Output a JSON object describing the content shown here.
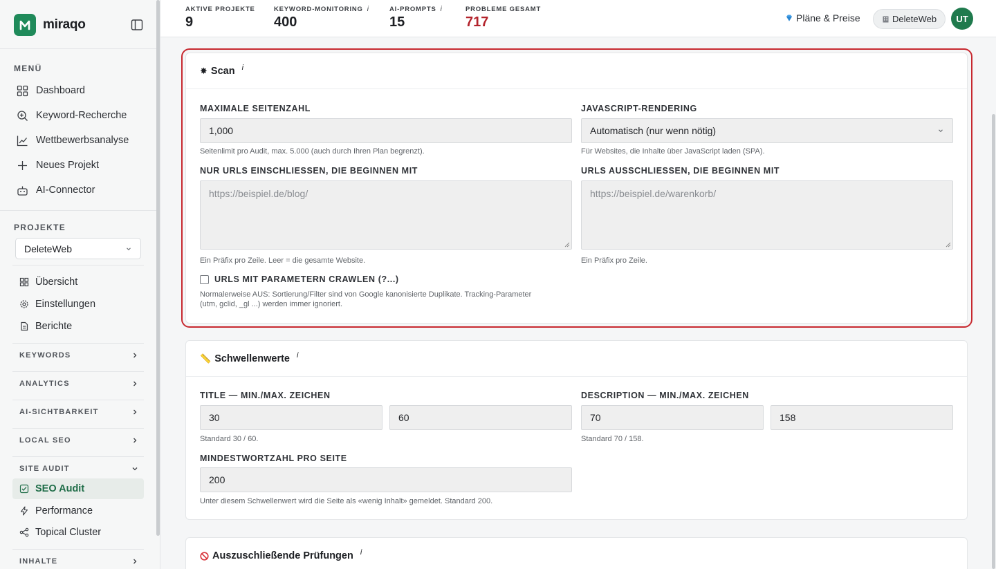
{
  "brand": {
    "name": "miraqo",
    "logo_letter": "M"
  },
  "sidebar": {
    "menu_heading": "MENÜ",
    "menu": [
      {
        "label": "Dashboard",
        "icon": "grid-icon"
      },
      {
        "label": "Keyword-Recherche",
        "icon": "search-plus-icon"
      },
      {
        "label": "Wettbewerbsanalyse",
        "icon": "line-chart-icon"
      },
      {
        "label": "Neues Projekt",
        "icon": "plus-icon"
      },
      {
        "label": "AI-Connector",
        "icon": "robot-icon"
      }
    ],
    "projects_heading": "PROJEKTE",
    "project_selected": "DeleteWeb",
    "project_items": [
      {
        "label": "Übersicht",
        "icon": "grid-icon"
      },
      {
        "label": "Einstellungen",
        "icon": "gear-icon"
      },
      {
        "label": "Berichte",
        "icon": "document-icon"
      }
    ],
    "groups": [
      "KEYWORDS",
      "ANALYTICS",
      "AI-SICHTBARKEIT",
      "LOCAL SEO"
    ],
    "site_audit": {
      "label": "SITE AUDIT",
      "items": [
        {
          "label": "SEO Audit",
          "icon": "check-square-icon"
        },
        {
          "label": "Performance",
          "icon": "lightning-icon"
        },
        {
          "label": "Topical Cluster",
          "icon": "share-icon"
        }
      ]
    },
    "last_group": "INHALTE"
  },
  "topbar": {
    "stats": [
      {
        "label": "AKTIVE PROJEKTE",
        "value": "9",
        "info": ""
      },
      {
        "label": "KEYWORD-MONITORING",
        "value": "400",
        "info": "i"
      },
      {
        "label": "AI-PROMPTS",
        "value": "15",
        "info": "i"
      },
      {
        "label": "PROBLEME GESAMT",
        "value": "717",
        "info": ""
      }
    ],
    "plans_label": "Pläne & Preise",
    "project_chip": "DeleteWeb",
    "avatar_initials": "UT"
  },
  "scan": {
    "title": "Scan",
    "info": "i",
    "max_pages": {
      "label": "MAXIMALE SEITENZAHL",
      "value": "1,000",
      "help": "Seitenlimit pro Audit, max. 5.000 (auch durch Ihren Plan begrenzt)."
    },
    "js_rendering": {
      "label": "JAVASCRIPT-RENDERING",
      "value": "Automatisch (nur wenn nötig)",
      "help": "Für Websites, die Inhalte über JavaScript laden (SPA)."
    },
    "include_urls": {
      "label": "NUR URLS EINSCHLIESSEN, DIE BEGINNEN MIT",
      "placeholder": "https://beispiel.de/blog/",
      "help": "Ein Präfix pro Zeile. Leer = die gesamte Website."
    },
    "exclude_urls": {
      "label": "URLS AUSSCHLIESSEN, DIE BEGINNEN MIT",
      "placeholder": "https://beispiel.de/warenkorb/",
      "help": "Ein Präfix pro Zeile."
    },
    "params": {
      "label": "URLS MIT PARAMETERN CRAWLEN (?...)",
      "help_1": "Normalerweise AUS: Sortierung/Filter sind von Google kanonisierte Duplikate. Tracking-Parameter",
      "help_2": "(utm, gclid, _gl ...) werden immer ignoriert."
    }
  },
  "thresholds": {
    "title": "Schwellenwerte",
    "info": "i",
    "title_chars": {
      "label": "TITLE — MIN./MAX. ZEICHEN",
      "min": "30",
      "max": "60",
      "help": "Standard 30 / 60."
    },
    "desc_chars": {
      "label": "DESCRIPTION — MIN./MAX. ZEICHEN",
      "min": "70",
      "max": "158",
      "help": "Standard 70 / 158."
    },
    "min_words": {
      "label": "MINDESTWORTZAHL PRO SEITE",
      "value": "200",
      "help": "Unter diesem Schwellenwert wird die Seite als «wenig Inhalt» gemeldet. Standard 200."
    }
  },
  "exclusions": {
    "title": "Auszuschließende Prüfungen",
    "info": "i"
  },
  "colors": {
    "brand": "#1f8a5a",
    "highlight": "#c7282f",
    "problems": "#b3232c"
  }
}
